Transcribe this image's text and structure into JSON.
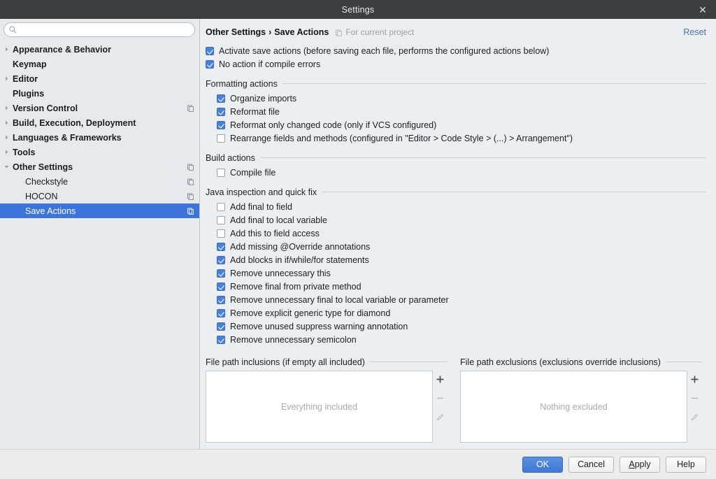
{
  "window": {
    "title": "Settings",
    "close_icon": "close-icon"
  },
  "sidebar": {
    "search": {
      "value": "",
      "placeholder": "",
      "icon": "search-icon"
    },
    "items": [
      {
        "label": "Appearance & Behavior",
        "level": 0,
        "arrow": "collapsed",
        "scope": false,
        "selected": false
      },
      {
        "label": "Keymap",
        "level": 0,
        "arrow": "none",
        "scope": false,
        "selected": false
      },
      {
        "label": "Editor",
        "level": 0,
        "arrow": "collapsed",
        "scope": false,
        "selected": false
      },
      {
        "label": "Plugins",
        "level": 0,
        "arrow": "none",
        "scope": false,
        "selected": false
      },
      {
        "label": "Version Control",
        "level": 0,
        "arrow": "collapsed",
        "scope": true,
        "selected": false
      },
      {
        "label": "Build, Execution, Deployment",
        "level": 0,
        "arrow": "collapsed",
        "scope": false,
        "selected": false
      },
      {
        "label": "Languages & Frameworks",
        "level": 0,
        "arrow": "collapsed",
        "scope": false,
        "selected": false
      },
      {
        "label": "Tools",
        "level": 0,
        "arrow": "collapsed",
        "scope": false,
        "selected": false
      },
      {
        "label": "Other Settings",
        "level": 0,
        "arrow": "expanded",
        "scope": true,
        "selected": false
      },
      {
        "label": "Checkstyle",
        "level": 1,
        "arrow": "none",
        "scope": true,
        "selected": false
      },
      {
        "label": "HOCON",
        "level": 1,
        "arrow": "none",
        "scope": true,
        "selected": false
      },
      {
        "label": "Save Actions",
        "level": 1,
        "arrow": "none",
        "scope": true,
        "selected": true
      }
    ]
  },
  "content": {
    "breadcrumb": {
      "parent": "Other Settings",
      "separator": "›",
      "current": "Save Actions"
    },
    "scope_note": "For current project",
    "reset_label": "Reset",
    "top_options": [
      {
        "label": "Activate save actions (before saving each file, performs the configured actions below)",
        "checked": true
      },
      {
        "label": "No action if compile errors",
        "checked": true
      }
    ],
    "sections": [
      {
        "title": "Formatting actions",
        "options": [
          {
            "label": "Organize imports",
            "checked": true
          },
          {
            "label": "Reformat file",
            "checked": true
          },
          {
            "label": "Reformat only changed code (only if VCS configured)",
            "checked": true
          },
          {
            "label": "Rearrange fields and methods (configured in \"Editor > Code Style > (...) > Arrangement\")",
            "checked": false
          }
        ]
      },
      {
        "title": "Build actions",
        "options": [
          {
            "label": "Compile file",
            "checked": false
          }
        ]
      },
      {
        "title": "Java inspection and quick fix",
        "options": [
          {
            "label": "Add final to field",
            "checked": false
          },
          {
            "label": "Add final to local variable",
            "checked": false
          },
          {
            "label": "Add this to field access",
            "checked": false
          },
          {
            "label": "Add missing @Override annotations",
            "checked": true
          },
          {
            "label": "Add blocks in if/while/for statements",
            "checked": true
          },
          {
            "label": "Remove unnecessary this",
            "checked": true
          },
          {
            "label": "Remove final from private method",
            "checked": true
          },
          {
            "label": "Remove unnecessary final to local variable or parameter",
            "checked": true
          },
          {
            "label": "Remove explicit generic type for diamond",
            "checked": true
          },
          {
            "label": "Remove unused suppress warning annotation",
            "checked": true
          },
          {
            "label": "Remove unnecessary semicolon",
            "checked": true
          }
        ]
      }
    ],
    "path_panels": [
      {
        "title": "File path inclusions (if empty all included)",
        "empty_text": "Everything included"
      },
      {
        "title": "File path exclusions (exclusions override inclusions)",
        "empty_text": "Nothing excluded"
      }
    ],
    "path_tools": [
      {
        "name": "add-path-button",
        "icon": "plus-icon",
        "enabled": true
      },
      {
        "name": "remove-path-button",
        "icon": "minus-icon",
        "enabled": false
      },
      {
        "name": "edit-path-button",
        "icon": "pencil-icon",
        "enabled": false
      }
    ]
  },
  "footer": {
    "ok": "OK",
    "cancel": "Cancel",
    "apply_prefix": "A",
    "apply_rest": "pply",
    "help": "Help"
  },
  "colors": {
    "accent": "#3d74da",
    "checkbox": "#4a80d6",
    "titlebar": "#3b3f41",
    "link": "#4a6fa5"
  }
}
